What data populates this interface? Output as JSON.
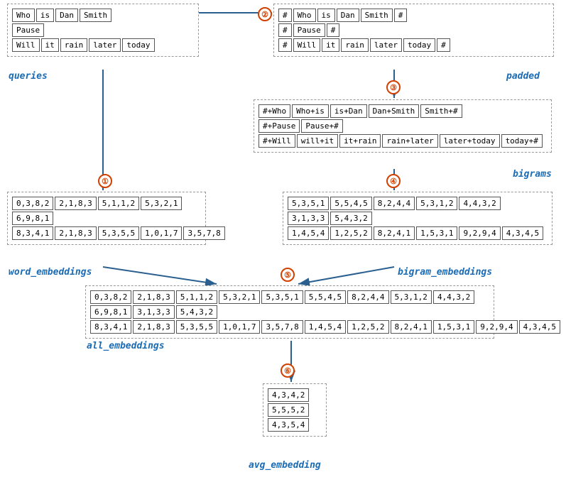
{
  "labels": {
    "queries": "queries",
    "padded": "padded",
    "bigrams": "bigrams",
    "word_embeddings": "word_embeddings",
    "bigram_embeddings": "bigram_embeddings",
    "all_embeddings": "all_embeddings",
    "avg_embedding": "avg_embedding"
  },
  "queries_box": {
    "rows": [
      [
        "Who",
        "is",
        "Dan",
        "Smith"
      ],
      [
        "Pause"
      ],
      [
        "Will",
        "it",
        "rain",
        "later",
        "today"
      ]
    ]
  },
  "padded_box": {
    "rows": [
      [
        "#",
        "Who",
        "is",
        "Dan",
        "Smith",
        "#"
      ],
      [
        "#",
        "Pause",
        "#"
      ],
      [
        "#",
        "Will",
        "it",
        "rain",
        "later",
        "today",
        "#"
      ]
    ]
  },
  "bigrams_box": {
    "rows": [
      [
        "#+Who",
        "Who+is",
        "is+Dan",
        "Dan+Smith",
        "Smith+#"
      ],
      [
        "#+Pause",
        "Pause+#"
      ],
      [
        "#+Will",
        "will+it",
        "it+rain",
        "rain+later",
        "later+today",
        "today+#"
      ]
    ]
  },
  "word_embeddings_box": {
    "rows": [
      [
        "0,3,8,2",
        "2,1,8,3",
        "5,1,1,2",
        "5,3,2,1"
      ],
      [
        "6,9,8,1"
      ],
      [
        "8,3,4,1",
        "2,1,8,3",
        "5,3,5,5",
        "1,0,1,7",
        "3,5,7,8"
      ]
    ]
  },
  "bigram_embeddings_box": {
    "rows": [
      [
        "5,3,5,1",
        "5,5,4,5",
        "8,2,4,4",
        "5,3,1,2",
        "4,4,3,2"
      ],
      [
        "3,1,3,3",
        "5,4,3,2"
      ],
      [
        "1,4,5,4",
        "1,2,5,2",
        "8,2,4,1",
        "1,5,3,1",
        "9,2,9,4",
        "4,3,4,5"
      ]
    ]
  },
  "all_embeddings_box": {
    "rows": [
      [
        "0,3,8,2",
        "2,1,8,3",
        "5,1,1,2",
        "5,3,2,1",
        "5,3,5,1",
        "5,5,4,5",
        "8,2,4,4",
        "5,3,1,2",
        "4,4,3,2"
      ],
      [
        "6,9,8,1",
        "3,1,3,3",
        "5,4,3,2"
      ],
      [
        "8,3,4,1",
        "2,1,8,3",
        "5,3,5,5",
        "1,0,1,7",
        "3,5,7,8",
        "1,4,5,4",
        "1,2,5,2",
        "8,2,4,1",
        "1,5,3,1",
        "9,2,9,4",
        "4,3,4,5"
      ]
    ]
  },
  "avg_embedding_box": {
    "rows": [
      [
        "4,3,4,2"
      ],
      [
        "5,5,5,2"
      ],
      [
        "4,3,5,4"
      ]
    ]
  },
  "step_numbers": [
    "①",
    "②",
    "③",
    "④",
    "⑤",
    "⑥"
  ]
}
